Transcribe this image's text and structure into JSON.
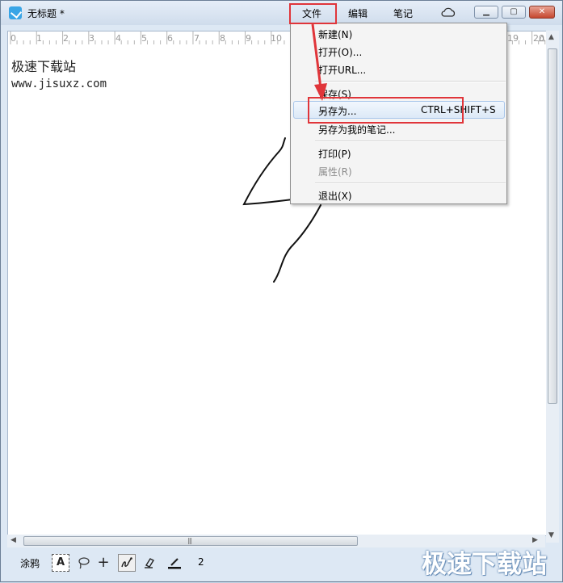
{
  "window": {
    "title": "无标题 *"
  },
  "menubar": {
    "file": "文件",
    "edit": "编辑",
    "notes": "笔记",
    "cloud_icon": "cloud-icon"
  },
  "window_controls": {
    "minimize": "minimize-icon",
    "restore": "restore-icon",
    "close": "close-icon"
  },
  "ruler": {
    "numbers": [
      "0",
      "1",
      "2",
      "3",
      "4",
      "5",
      "6",
      "7",
      "8",
      "9",
      "10",
      "19",
      "20"
    ]
  },
  "document": {
    "line1": "极速下载站",
    "line2": "www.jisuxz.com"
  },
  "file_menu": {
    "items": [
      {
        "label": "新建(N)",
        "enabled": true
      },
      {
        "label": "打开(O)...",
        "enabled": true
      },
      {
        "label": "打开URL...",
        "enabled": true
      },
      {
        "label": "保存(S)",
        "enabled": true
      },
      {
        "label": "另存为...",
        "shortcut": "CTRL+SHIFT+S",
        "enabled": true,
        "highlighted": true
      },
      {
        "label": "另存为我的笔记...",
        "enabled": true
      },
      {
        "label": "打印(P)",
        "enabled": true
      },
      {
        "label": "属性(R)",
        "enabled": false
      },
      {
        "label": "退出(X)",
        "enabled": true
      }
    ]
  },
  "toolbar": {
    "label": "涂鸦",
    "text_tool": "A",
    "tools": [
      "text-tool-icon",
      "lasso-icon",
      "add-icon",
      "pen-icon",
      "eraser-icon",
      "line-width-icon"
    ],
    "pen_width": "2"
  },
  "watermark": "极速下载站",
  "annotation_color": "#e0353a"
}
